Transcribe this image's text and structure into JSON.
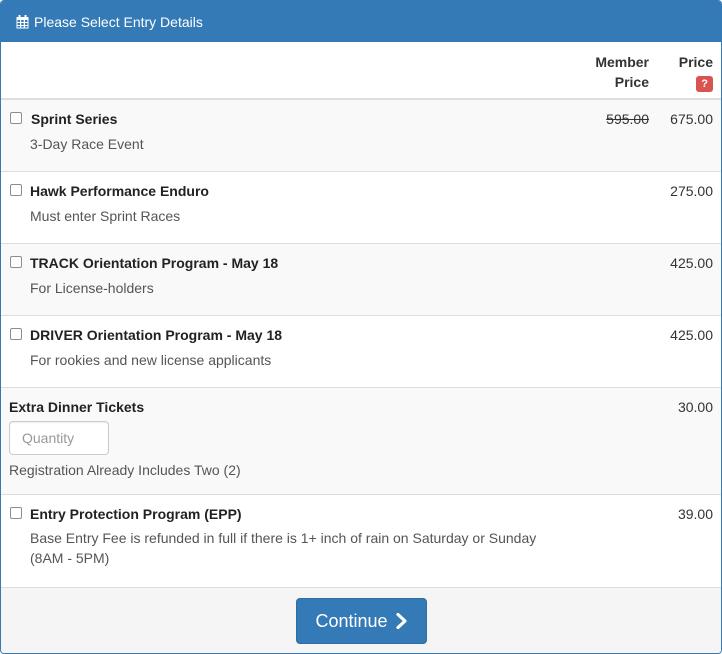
{
  "header": {
    "title": "Please Select Entry Details",
    "icon": "calendar-icon"
  },
  "table": {
    "col_member_line1": "Member",
    "col_member_line2": "Price",
    "col_price": "Price",
    "help_badge": "?"
  },
  "items": [
    {
      "title": "Sprint Series",
      "subtitle": "3-Day Race Event",
      "member_price": "595.00",
      "price": "675.00"
    },
    {
      "title": "Hawk Performance Enduro",
      "subtitle": "Must enter Sprint Races",
      "price": "275.00"
    },
    {
      "title": "TRACK Orientation Program - May 18",
      "subtitle": "For License-holders",
      "price": "425.00"
    },
    {
      "title": "DRIVER Orientation Program - May 18",
      "subtitle": "For rookies and new license applicants",
      "price": "425.00"
    }
  ],
  "extra": {
    "title": "Extra Dinner Tickets",
    "price": "30.00",
    "quantity_placeholder": "Quantity",
    "note": "Registration Already Includes Two (2)"
  },
  "epp": {
    "title": "Entry Protection Program (EPP)",
    "subtitle": "Base Entry Fee is refunded in full if there is 1+ inch of rain on Saturday or Sunday (8AM - 5PM)",
    "price": "39.00"
  },
  "footer": {
    "continue_label": "Continue"
  },
  "colors": {
    "primary": "#337ab7",
    "danger": "#d9534f",
    "stripe": "#f9f9f9"
  }
}
